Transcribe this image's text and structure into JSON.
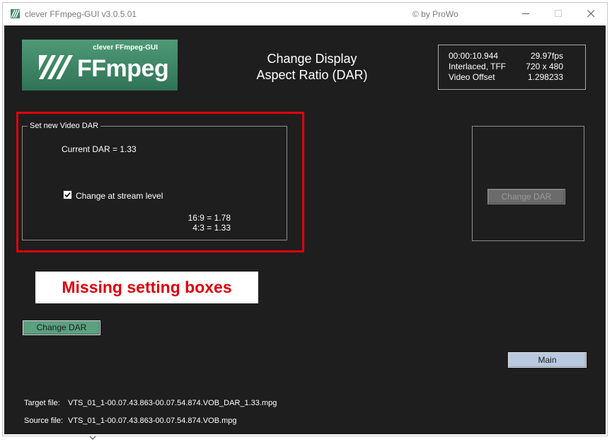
{
  "window": {
    "title": "clever FFmpeg-GUI v3.0.5.01",
    "copyright": "© by ProWo"
  },
  "logo": {
    "small_text": "clever FFmpeg-GUI",
    "big_text": "FFmpeg"
  },
  "page": {
    "title_line1": "Change Display",
    "title_line2": "Aspect Ratio (DAR)"
  },
  "info": {
    "duration": "00:00:10.944",
    "fps": "29.97fps",
    "scan": "Interlaced, TFF",
    "resolution": "720 x 480",
    "offset_label": "Video Offset",
    "offset_value": "1.298233"
  },
  "groupbox": {
    "legend": "Set new Video DAR",
    "current_dar": "Current DAR = 1.33",
    "checkbox_label": "Change at stream level",
    "checkbox_checked": true,
    "ratio_169": "16:9 = 1.78",
    "ratio_43": "4:3 = 1.33"
  },
  "side_panel": {
    "button_label": "Change DAR"
  },
  "annotation": {
    "text": "Missing setting boxes"
  },
  "buttons": {
    "change_dar": "Change DAR",
    "main": "Main"
  },
  "files": {
    "target_label": "Target file:",
    "target_value": "VTS_01_1-00.07.43.863-00.07.54.874.VOB_DAR_1.33.mpg",
    "source_label": "Source file:",
    "source_value": "VTS_01_1-00.07.43.863-00.07.54.874.VOB.mpg"
  },
  "colors": {
    "background": "#1e1e1e",
    "accent_green": "#5ca080",
    "highlight_red": "#e0000b",
    "main_button": "#b8c9e0"
  },
  "icons": {
    "app": "ffmpeg-app-icon",
    "minimize": "minimize-icon",
    "maximize": "maximize-icon",
    "close": "close-icon"
  }
}
